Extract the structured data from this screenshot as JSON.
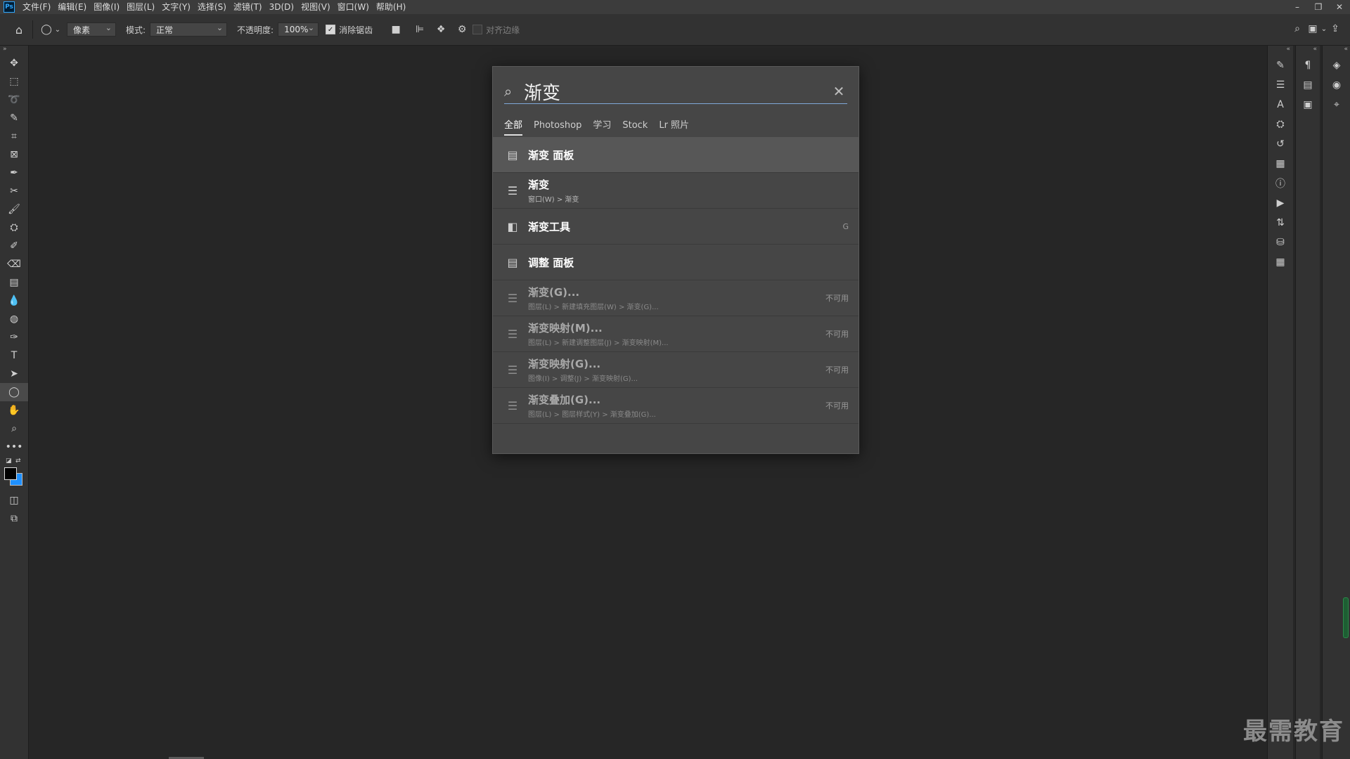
{
  "app": {
    "logo_text": "Ps"
  },
  "menu": [
    "文件(F)",
    "编辑(E)",
    "图像(I)",
    "图层(L)",
    "文字(Y)",
    "选择(S)",
    "滤镜(T)",
    "3D(D)",
    "视图(V)",
    "窗口(W)",
    "帮助(H)"
  ],
  "window_controls": {
    "minimize": "–",
    "restore": "❐",
    "close": "✕"
  },
  "options": {
    "shape_mode": "像素",
    "mode_label": "模式:",
    "mode_value": "正常",
    "opacity_label": "不透明度:",
    "opacity_value": "100%",
    "antialias_label": "消除锯齿",
    "align_edges_label": "对齐边缘"
  },
  "search": {
    "query": "渐变",
    "tabs": [
      "全部",
      "Photoshop",
      "学习",
      "Stock",
      "Lr 照片"
    ],
    "active_tab": "全部",
    "results": [
      {
        "title": "渐变 面板",
        "subtitle": "",
        "right": "",
        "icon": "panel-icon",
        "state": "selected"
      },
      {
        "title": "渐变",
        "subtitle": "窗口(W) > 渐变",
        "right": "",
        "icon": "menu-icon",
        "state": "normal"
      },
      {
        "title": "渐变工具",
        "subtitle": "",
        "right": "G",
        "icon": "gradient-tool-icon",
        "state": "normal"
      },
      {
        "title": "调整 面板",
        "subtitle": "",
        "right": "",
        "icon": "panel-icon",
        "state": "normal"
      },
      {
        "title": "渐变(G)...",
        "subtitle": "图层(L) > 新建填充图层(W) > 渐变(G)...",
        "right": "不可用",
        "icon": "menu-icon",
        "state": "disabled"
      },
      {
        "title": "渐变映射(M)...",
        "subtitle": "图层(L) > 新建调整图层(J) > 渐变映射(M)...",
        "right": "不可用",
        "icon": "menu-icon",
        "state": "disabled"
      },
      {
        "title": "渐变映射(G)...",
        "subtitle": "图像(I) > 调整(J) > 渐变映射(G)...",
        "right": "不可用",
        "icon": "menu-icon",
        "state": "disabled"
      },
      {
        "title": "渐变叠加(G)...",
        "subtitle": "图层(L) > 图层样式(Y) > 渐变叠加(G)...",
        "right": "不可用",
        "icon": "menu-icon",
        "state": "disabled"
      }
    ]
  },
  "watermark": "最需教育",
  "colors": {
    "foreground": "#000000",
    "background": "#1e90ff",
    "accent": "#7fa8d8"
  }
}
